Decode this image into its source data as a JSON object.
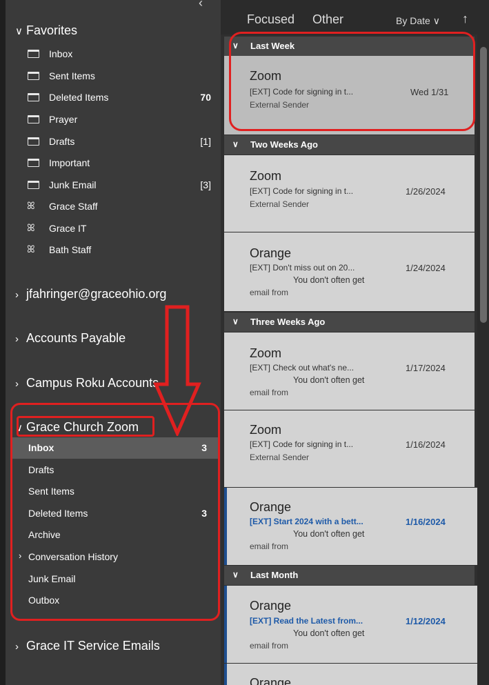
{
  "sidebar": {
    "favorites_label": "Favorites",
    "favorites": [
      {
        "label": "Inbox",
        "count": "",
        "icon": "folder-icon"
      },
      {
        "label": "Sent Items",
        "count": "",
        "icon": "folder-icon"
      },
      {
        "label": "Deleted Items",
        "count": "70",
        "icon": "folder-icon"
      },
      {
        "label": "Prayer",
        "count": "",
        "icon": "folder-icon"
      },
      {
        "label": "Drafts",
        "count": "[1]",
        "icon": "folder-icon"
      },
      {
        "label": "Important",
        "count": "",
        "icon": "folder-icon"
      },
      {
        "label": "Junk Email",
        "count": "[3]",
        "icon": "folder-icon"
      },
      {
        "label": "Grace Staff",
        "count": "",
        "icon": "group-icon"
      },
      {
        "label": "Grace IT",
        "count": "",
        "icon": "group-icon"
      },
      {
        "label": "Bath Staff",
        "count": "",
        "icon": "group-icon"
      }
    ],
    "accounts": [
      {
        "label": "jfahringer@graceohio.org"
      },
      {
        "label": "Accounts Payable"
      },
      {
        "label": "Campus Roku Accounts"
      }
    ],
    "zoom_account": {
      "label": "Grace Church Zoom",
      "folders": [
        {
          "label": "Inbox",
          "count": "3",
          "selected": true
        },
        {
          "label": "Drafts",
          "count": ""
        },
        {
          "label": "Sent Items",
          "count": ""
        },
        {
          "label": "Deleted Items",
          "count": "3"
        },
        {
          "label": "Archive",
          "count": ""
        },
        {
          "label": "Conversation History",
          "count": "",
          "expandable": true
        },
        {
          "label": "Junk Email",
          "count": ""
        },
        {
          "label": "Outbox",
          "count": ""
        }
      ]
    },
    "after_accounts": [
      {
        "label": "Grace IT Service Emails"
      }
    ]
  },
  "list": {
    "tabs": [
      "Focused",
      "Other"
    ],
    "sort_label": "By Date",
    "sections": [
      {
        "label": "Last Week"
      },
      {
        "label": "Two Weeks Ago"
      },
      {
        "label": "Three Weeks Ago"
      },
      {
        "label": "Last Month"
      }
    ],
    "messages": [
      {
        "sender": "Zoom",
        "subject": "[EXT] Code for signing in t...",
        "date": "Wed 1/31",
        "line2": "External Sender",
        "line3": ""
      },
      {
        "sender": "Zoom",
        "subject": "[EXT] Code for signing in t...",
        "date": "1/26/2024",
        "line2": "External Sender",
        "line3": ""
      },
      {
        "sender": "Orange",
        "subject": "[EXT] Don't miss out on 20...",
        "date": "1/24/2024",
        "line2": "You don't often get",
        "line3": "email from"
      },
      {
        "sender": "Zoom",
        "subject": "[EXT] Check out what's ne...",
        "date": "1/17/2024",
        "line2": "You don't often get",
        "line3": "email from"
      },
      {
        "sender": "Zoom",
        "subject": "[EXT] Code for signing in t...",
        "date": "1/16/2024",
        "line2": "External Sender",
        "line3": ""
      },
      {
        "sender": "Orange",
        "subject": "[EXT] Start 2024 with a bett...",
        "date": "1/16/2024",
        "line2": "You don't often get",
        "line3": "email from"
      },
      {
        "sender": "Orange",
        "subject": "[EXT] Read the Latest from...",
        "date": "1/12/2024",
        "line2": "You don't often get",
        "line3": "email from"
      },
      {
        "sender": "Orange",
        "subject": "",
        "date": "",
        "line2": "",
        "line3": ""
      }
    ]
  },
  "colors": {
    "annotation": "#e02020",
    "unread_accent": "#1e5aa8"
  }
}
